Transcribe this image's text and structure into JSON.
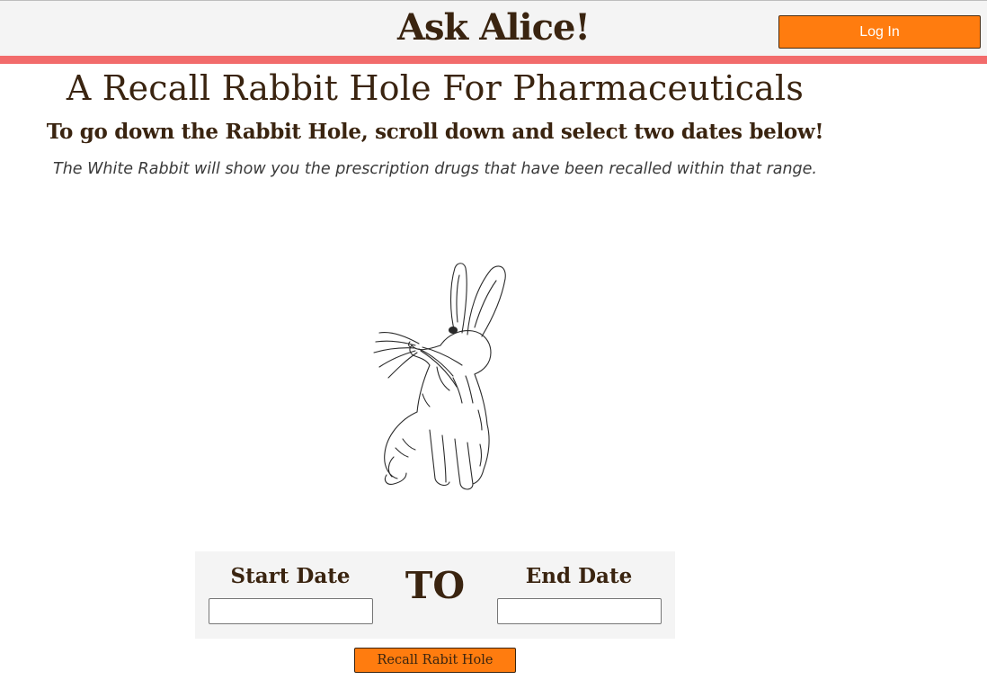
{
  "header": {
    "app_title": "Ask Alice!",
    "login_label": "Log In"
  },
  "intro": {
    "title": "A Recall Rabbit Hole For Pharmaceuticals",
    "subtitle": "To go down the Rabbit Hole, scroll down and select two dates below!",
    "description": "The White Rabbit will show you the prescription drugs that have been recalled within that range."
  },
  "illustration": {
    "icon": "rabbit-illustration"
  },
  "date_range": {
    "start_label": "Start Date",
    "start_value": "",
    "separator": "TO",
    "end_label": "End Date",
    "end_value": ""
  },
  "actions": {
    "recall_label": "Recall Rabit Hole"
  },
  "colors": {
    "accent_orange": "#ff7c0f",
    "stripe_red": "#f26b6b",
    "text_brown": "#3a2410",
    "header_bg": "#f4f4f4"
  }
}
